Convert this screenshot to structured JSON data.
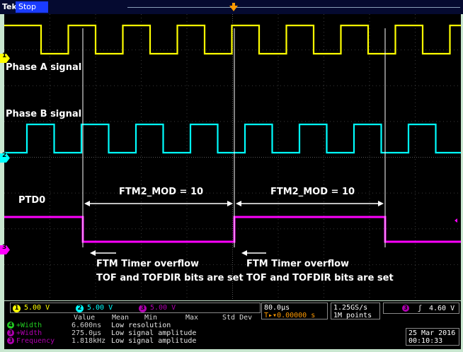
{
  "app": {
    "logo_text": "Tek",
    "run_state": "Stop"
  },
  "colors": {
    "ch1": "#ffff00",
    "ch2": "#00ffff",
    "ch3": "#ff00ff",
    "annotation": "#ffffff",
    "status_bg": "#c8e6cf"
  },
  "channel_markers": {
    "ch1": "1",
    "ch2": "2",
    "ch3": "3"
  },
  "labels": {
    "phase_a": "Phase A signal",
    "phase_b": "Phase B signal",
    "ptd0": "PTD0",
    "mod_left": "FTM2_MOD = 10",
    "mod_right": "FTM2_MOD = 10",
    "overflow_left_1": "FTM Timer overflow",
    "overflow_left_2": "TOF and TOFDIR bits are set",
    "overflow_right_1": "FTM Timer overflow",
    "overflow_right_2": "TOF and TOFDIR bits are set"
  },
  "channels": [
    {
      "num": "1",
      "scale": "5.00 V"
    },
    {
      "num": "2",
      "scale": "5.00 V"
    },
    {
      "num": "3",
      "scale": "5.00 V"
    }
  ],
  "timebase": {
    "scale": "80.0µs",
    "delay": "0.00000 s",
    "delay_prefix": "T▸▾"
  },
  "acquisition": {
    "rate": "1.25GS/s",
    "points": "1M points"
  },
  "trigger": {
    "source": "3",
    "slope": "ʃ",
    "level": "4.60 V"
  },
  "datetime": {
    "date": "25 Mar 2016",
    "time": "00:10:33"
  },
  "measurements": {
    "headers": [
      "Value",
      "Mean",
      "Min",
      "Max",
      "Std Dev"
    ],
    "rows": [
      {
        "ch": "4",
        "name": "+Width",
        "value": "6.600ns",
        "note": "Low resolution"
      },
      {
        "ch": "3",
        "name": "+Width",
        "value": "275.0µs",
        "note": "Low signal amplitude"
      },
      {
        "ch": "3",
        "name": "Frequency",
        "value": "1.818kHz",
        "note": "Low signal amplitude"
      }
    ]
  }
}
